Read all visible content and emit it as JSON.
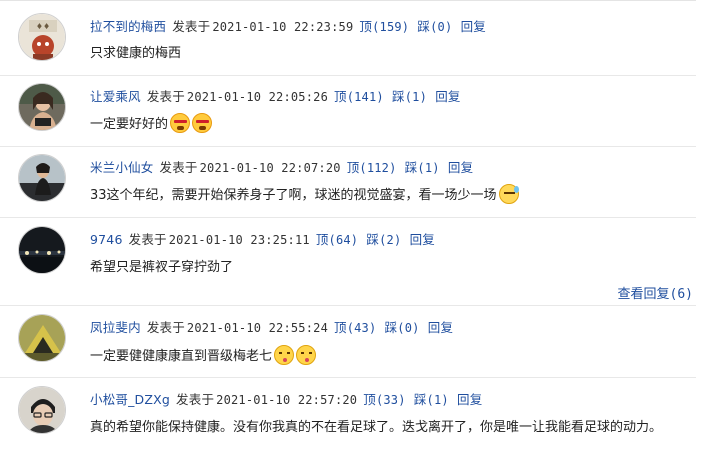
{
  "labels": {
    "published": "发表于",
    "up": "顶",
    "down": "踩",
    "reply": "回复"
  },
  "comments": [
    {
      "user": "拉不到的梅西",
      "datetime": "2021-01-10 22:23:59",
      "up": "(159)",
      "down": "(0)",
      "text": "只求健康的梅西",
      "emojis": []
    },
    {
      "user": "让爱乘风",
      "datetime": "2021-01-10 22:05:26",
      "up": "(141)",
      "down": "(1)",
      "text": "一定要好好的",
      "emojis": [
        "angry-face-emoji",
        "angry-face-emoji"
      ]
    },
    {
      "user": "米兰小仙女",
      "datetime": "2021-01-10 22:07:20",
      "up": "(112)",
      "down": "(1)",
      "text": "33这个年纪，需要开始保养身子了啊，球迷的视觉盛宴，看一场少一场",
      "emojis": [
        "sweat-face-emoji"
      ]
    },
    {
      "user": "9746",
      "datetime": "2021-01-10 23:25:11",
      "up": "(64)",
      "down": "(2)",
      "text": "希望只是裤衩子穿拧劲了",
      "emojis": []
    },
    {
      "user": "凤拉斐内",
      "datetime": "2021-01-10 22:55:24",
      "up": "(43)",
      "down": "(0)",
      "text": "一定要健健康康直到晋级梅老七",
      "emojis": [
        "kiss-face-emoji",
        "kiss-face-emoji"
      ]
    },
    {
      "user": "小松哥_DZXg",
      "datetime": "2021-01-10 22:57:20",
      "up": "(33)",
      "down": "(1)",
      "text": "真的希望你能保持健康。没有你我真的不在看足球了。迭戈离开了，你是唯一让我能看足球的动力。",
      "emojis": []
    }
  ],
  "view_replies": {
    "label": "查看回复",
    "count": "(6)"
  },
  "colors": {
    "link": "#1f4e9e",
    "text": "#222222",
    "separator": "#e8e8e8"
  }
}
